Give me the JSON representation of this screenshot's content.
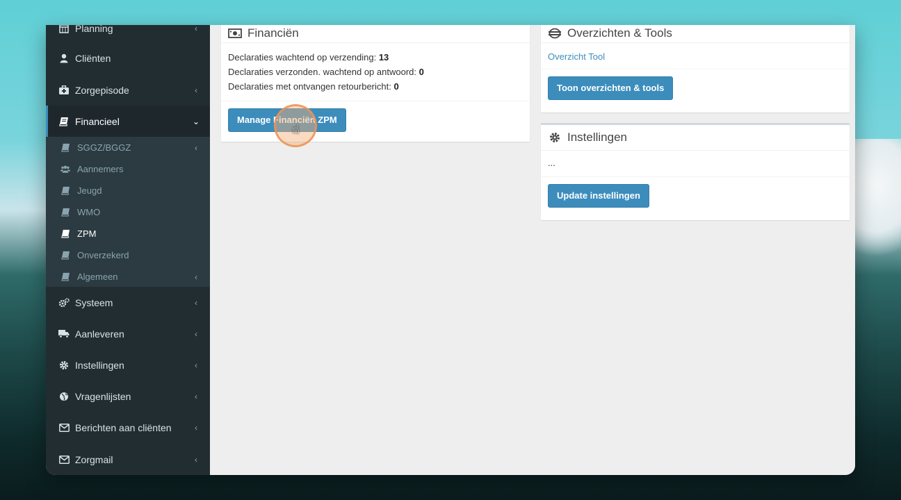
{
  "sidebar": {
    "items": [
      {
        "label": "Planning",
        "icon": "calendar-icon",
        "chevron": "‹"
      },
      {
        "label": "Cliënten",
        "icon": "user-icon",
        "chevron": ""
      },
      {
        "label": "Zorgepisode",
        "icon": "medkit-icon",
        "chevron": "‹"
      },
      {
        "label": "Financieel",
        "icon": "book-icon",
        "chevron": "⌄"
      },
      {
        "label": "Systeem",
        "icon": "cogs-icon",
        "chevron": "‹"
      },
      {
        "label": "Aanleveren",
        "icon": "truck-icon",
        "chevron": "‹"
      },
      {
        "label": "Instellingen",
        "icon": "gear-icon",
        "chevron": "‹"
      },
      {
        "label": "Vragenlijsten",
        "icon": "globe-icon",
        "chevron": "‹"
      },
      {
        "label": "Berichten aan cliënten",
        "icon": "envelope-icon",
        "chevron": "‹"
      },
      {
        "label": "Zorgmail",
        "icon": "envelope-icon",
        "chevron": "‹"
      }
    ],
    "submenu": [
      {
        "label": "SGGZ/BGGZ",
        "icon": "book-icon",
        "chevron": "‹"
      },
      {
        "label": "Aannemers",
        "icon": "users-icon",
        "chevron": ""
      },
      {
        "label": "Jeugd",
        "icon": "book-icon",
        "chevron": ""
      },
      {
        "label": "WMO",
        "icon": "book-icon",
        "chevron": ""
      },
      {
        "label": "ZPM",
        "icon": "book-icon",
        "chevron": ""
      },
      {
        "label": "Onverzekerd",
        "icon": "book-icon",
        "chevron": ""
      },
      {
        "label": "Algemeen",
        "icon": "book-icon",
        "chevron": "‹"
      }
    ]
  },
  "financien": {
    "title": "Financiën",
    "icon": "money-icon",
    "rows": [
      {
        "label": "Declaraties wachtend op verzending:",
        "value": "13"
      },
      {
        "label": "Declaraties verzonden. wachtend op antwoord:",
        "value": "0"
      },
      {
        "label": "Declaraties met ontvangen retourbericht:",
        "value": "0"
      }
    ],
    "button": "Manage Financiën ZPM"
  },
  "overzichten": {
    "title": "Overzichten & Tools",
    "icon": "tools-icon",
    "link": "Overzicht Tool",
    "button": "Toon overzichten & tools"
  },
  "instellingen": {
    "title": "Instellingen",
    "icon": "gear-icon",
    "body": "...",
    "button": "Update instellingen"
  },
  "colors": {
    "accent": "#3c8dbc",
    "sidebar": "#222d32",
    "highlight": "#f3b078"
  }
}
